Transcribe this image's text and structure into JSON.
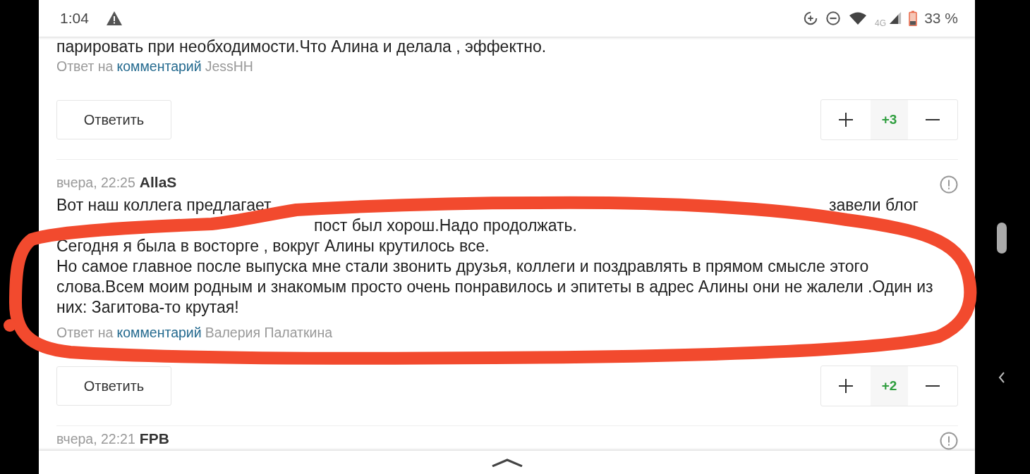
{
  "status_bar": {
    "time": "1:04",
    "network": "4G",
    "battery": "33 %"
  },
  "comments": [
    {
      "lines": [
        [
          {
            "kind": "text",
            "text": "парировать при необходимости.Что Алина и делала , эффектно."
          }
        ]
      ],
      "reply_prefix": "Ответ на",
      "reply_link": "комментарий",
      "reply_to": "JessHH",
      "reply_button": "Ответить",
      "score": "+3"
    },
    {
      "date": "вчера, 22:25",
      "author": "AllaS",
      "lines": [
        [
          {
            "kind": "text",
            "text": "Вот наш коллега предлагает"
          },
          {
            "kind": "covered"
          },
          {
            "kind": "text",
            "text": "завели блог"
          }
        ],
        [
          {
            "kind": "covered"
          },
          {
            "kind": "text",
            "text": "пост был хорош.Надо продолжать."
          }
        ],
        [
          {
            "kind": "text",
            "text": "Сегодня я была в восторге , вокруг Алины крутилось все."
          }
        ],
        [
          {
            "kind": "text",
            "text": "Но самое главное после выпуска мне стали звонить друзья, коллеги и поздравлять в прямом смысле этого"
          }
        ],
        [
          {
            "kind": "text",
            "text": "слова.Всем моим родным и знакомым просто очень понравилось и эпитеты в адрес Алины они не жалели .Один из"
          }
        ],
        [
          {
            "kind": "text",
            "text": "них: Загитова-то крутая!"
          }
        ]
      ],
      "reply_prefix": "Ответ на",
      "reply_link": "комментарий",
      "reply_to": "Валерия Палаткина",
      "reply_button": "Ответить",
      "score": "+2"
    },
    {
      "date": "вчера, 22:21",
      "author": "FPB"
    }
  ]
}
